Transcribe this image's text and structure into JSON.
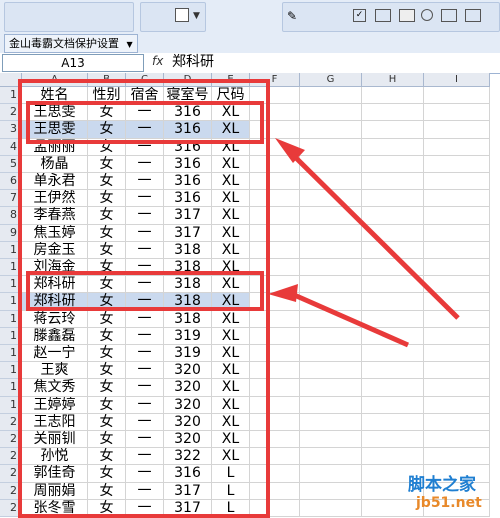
{
  "toolbar": {
    "add_in_label": "金山毒霸文档保护设置"
  },
  "formula_bar": {
    "name_box": "A13",
    "fx_symbol": "fx",
    "value": "郑科研"
  },
  "columns": [
    "A",
    "B",
    "C",
    "D",
    "E",
    "F",
    "G",
    "H",
    "I"
  ],
  "row_numbers": [
    "1",
    "2",
    "3",
    "4",
    "5",
    "6",
    "7",
    "8",
    "9",
    "1",
    "1",
    "1",
    "1",
    "1",
    "1",
    "1",
    "1",
    "1",
    "1",
    "2",
    "2",
    "2",
    "2",
    "2",
    "2",
    "2"
  ],
  "header_row": [
    "姓名",
    "性别",
    "宿舍",
    "寝室号",
    "尺码"
  ],
  "rows": [
    [
      "王思雯",
      "女",
      "一",
      "316",
      "XL"
    ],
    [
      "王思雯",
      "女",
      "一",
      "316",
      "XL"
    ],
    [
      "孟丽丽",
      "女",
      "一",
      "316",
      "XL"
    ],
    [
      "杨晶",
      "女",
      "一",
      "316",
      "XL"
    ],
    [
      "单永君",
      "女",
      "一",
      "316",
      "XL"
    ],
    [
      "王伊然",
      "女",
      "一",
      "316",
      "XL"
    ],
    [
      "李春燕",
      "女",
      "一",
      "317",
      "XL"
    ],
    [
      "焦玉婷",
      "女",
      "一",
      "317",
      "XL"
    ],
    [
      "房金玉",
      "女",
      "一",
      "318",
      "XL"
    ],
    [
      "刘海金",
      "女",
      "一",
      "318",
      "XL"
    ],
    [
      "郑科研",
      "女",
      "一",
      "318",
      "XL"
    ],
    [
      "郑科研",
      "女",
      "一",
      "318",
      "XL"
    ],
    [
      "蒋云玲",
      "女",
      "一",
      "318",
      "XL"
    ],
    [
      "滕鑫磊",
      "女",
      "一",
      "319",
      "XL"
    ],
    [
      "赵一宁",
      "女",
      "一",
      "319",
      "XL"
    ],
    [
      "王爽",
      "女",
      "一",
      "320",
      "XL"
    ],
    [
      "焦文秀",
      "女",
      "一",
      "320",
      "XL"
    ],
    [
      "王婷婷",
      "女",
      "一",
      "320",
      "XL"
    ],
    [
      "王志阳",
      "女",
      "一",
      "320",
      "XL"
    ],
    [
      "关丽钏",
      "女",
      "一",
      "320",
      "XL"
    ],
    [
      "孙悦",
      "女",
      "一",
      "322",
      "XL"
    ],
    [
      "郭佳奇",
      "女",
      "一",
      "316",
      "L"
    ],
    [
      "周丽娟",
      "女",
      "一",
      "317",
      "L"
    ],
    [
      "张冬雪",
      "女",
      "一",
      "317",
      "L"
    ]
  ],
  "watermark": {
    "brand": "脚本之家",
    "url": "jb51.net"
  },
  "colors": {
    "annotation": "#e83a3a",
    "selection": "#cad9ee"
  }
}
